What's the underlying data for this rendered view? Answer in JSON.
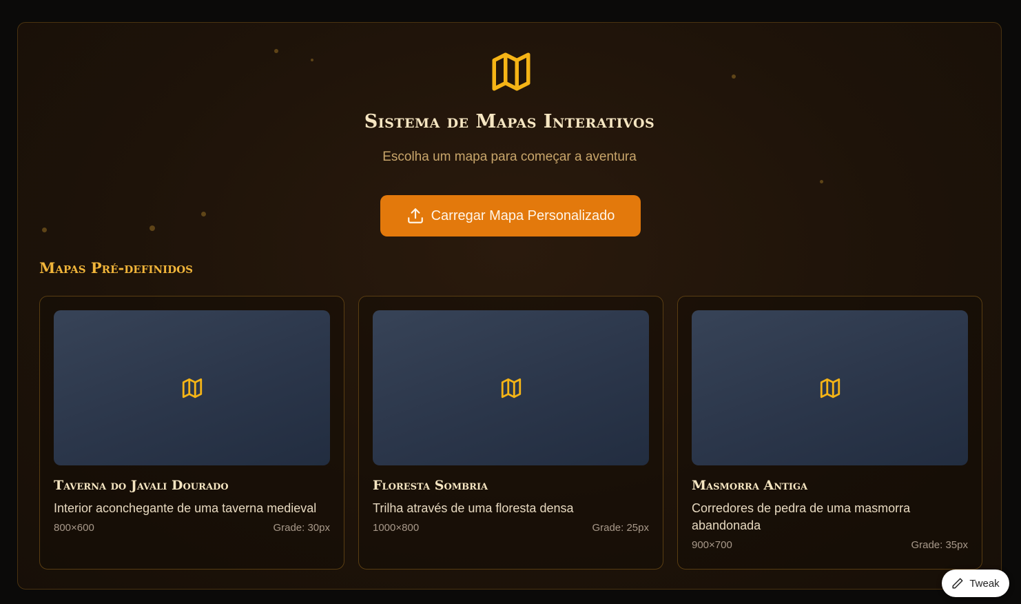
{
  "header": {
    "icon": "map-icon",
    "title": "Sistema de Mapas Interativos",
    "subtitle": "Escolha um mapa para começar a aventura"
  },
  "upload": {
    "icon": "upload-icon",
    "label": "Carregar Mapa Personalizado"
  },
  "predefined": {
    "title": "Mapas Pré-definidos",
    "maps": [
      {
        "name": "Taverna do Javali Dourado",
        "description": "Interior aconchegante de uma taverna medieval",
        "size": "800×600",
        "grid": "Grade: 30px"
      },
      {
        "name": "Floresta Sombria",
        "description": "Trilha através de uma floresta densa",
        "size": "1000×800",
        "grid": "Grade: 25px"
      },
      {
        "name": "Masmorra Antiga",
        "description": "Corredores de pedra de uma masmorra abandonada",
        "size": "900×700",
        "grid": "Grade: 35px"
      }
    ]
  },
  "tweak": {
    "icon": "pencil-icon",
    "label": "Tweak"
  },
  "colors": {
    "accent": "#e3790c",
    "gold": "#f1b53a",
    "icon_gold": "#f5b416",
    "background": "#1e1309"
  }
}
